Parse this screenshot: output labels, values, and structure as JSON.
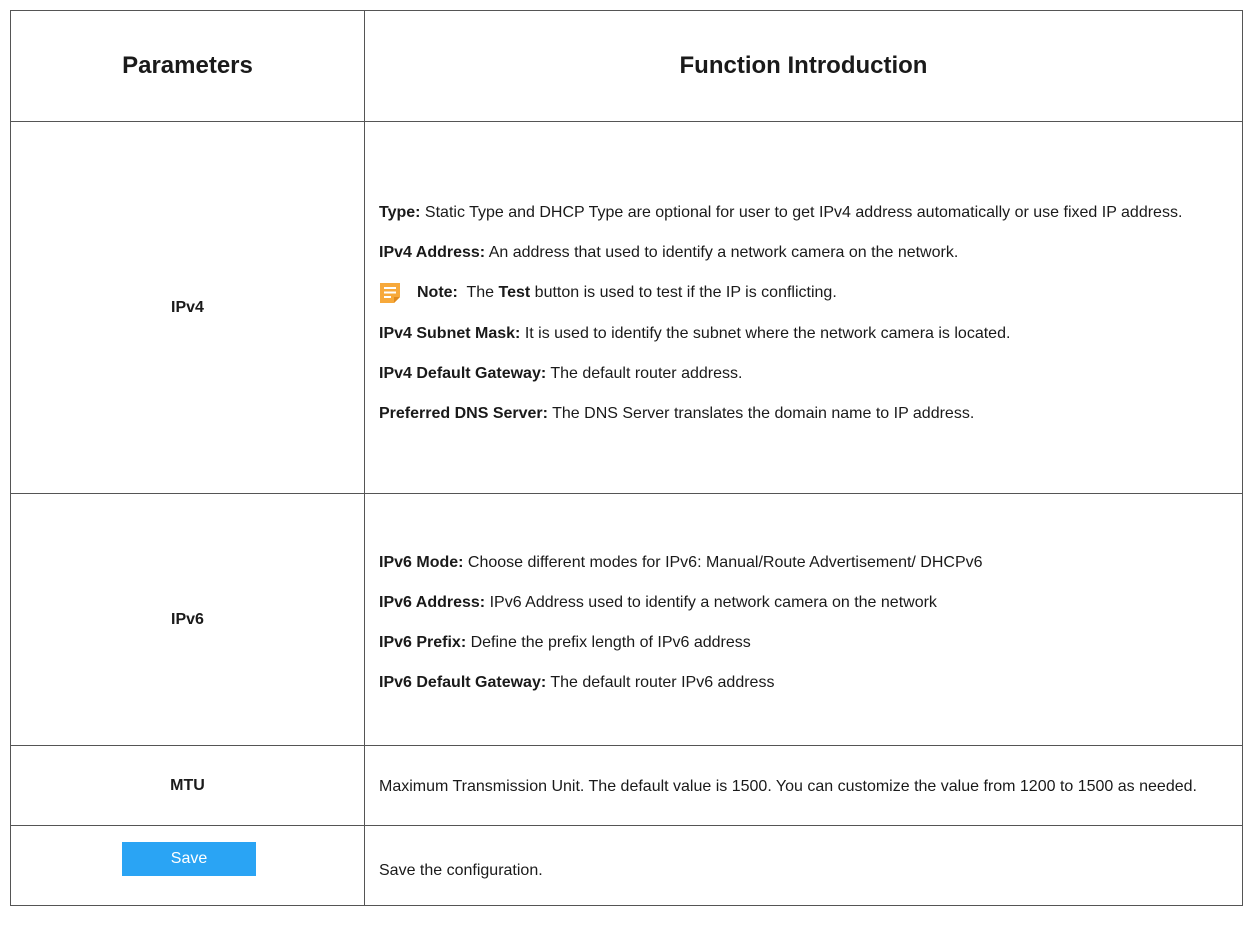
{
  "header": {
    "col_parameters": "Parameters",
    "col_function": "Function Introduction"
  },
  "rows": {
    "ipv4": {
      "name": "IPv4",
      "type_label": "Type:",
      "type_text": " Static Type and DHCP Type are optional for user to get IPv4 address automatically or use fixed IP address.",
      "address_label": "IPv4 Address:",
      "address_text": " An address that used to identify a network camera on the network.",
      "note_label": "Note:",
      "note_pre": "  The ",
      "note_bold": "Test",
      "note_post": " button is used to test if the IP is conflicting.",
      "subnet_label": "IPv4 Subnet Mask:",
      "subnet_text": " It is used to identify the subnet where the network camera is located.",
      "gateway_label": "IPv4 Default Gateway:",
      "gateway_text": " The default router address.",
      "dns_label": "Preferred DNS Server:",
      "dns_text": " The DNS Server translates the domain name to IP address."
    },
    "ipv6": {
      "name": "IPv6",
      "mode_label": "IPv6 Mode:",
      "mode_text": " Choose different modes for IPv6: Manual/Route Advertisement/ DHCPv6",
      "address_label": "IPv6 Address:",
      "address_text": " IPv6 Address used to identify a network camera on the network",
      "prefix_label": "IPv6 Prefix:",
      "prefix_text": " Define the prefix length of IPv6 address",
      "gateway_label": "IPv6 Default Gateway:",
      "gateway_text": " The default router IPv6 address"
    },
    "mtu": {
      "name": "MTU",
      "text": "Maximum Transmission Unit. The default value is 1500. You can customize the value from 1200 to 1500 as needed."
    },
    "save": {
      "button_label": "Save",
      "text": "Save the configuration."
    }
  },
  "icons": {
    "note": "note-icon"
  },
  "colors": {
    "save_button": "#2aa4f4",
    "note_icon": "#f7a93b"
  }
}
